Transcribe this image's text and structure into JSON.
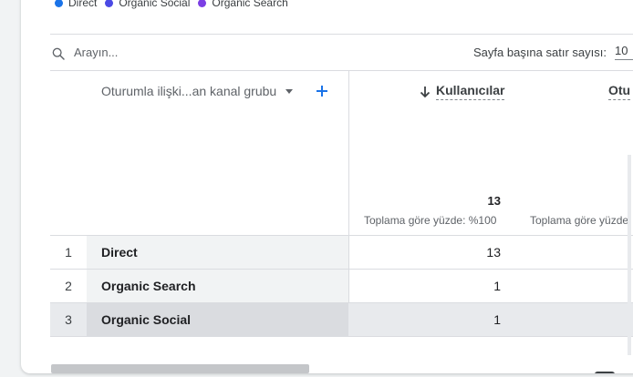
{
  "legend": [
    {
      "label": "Direct",
      "color": "#1a73e8"
    },
    {
      "label": "Organic Social",
      "color": "#4b4ae4"
    },
    {
      "label": "Organic Search",
      "color": "#7b3fe4"
    }
  ],
  "search": {
    "placeholder": "Arayın..."
  },
  "pagination": {
    "rows_per_page_label": "Sayfa başına satır sayısı:",
    "rows_per_page_value": "10"
  },
  "table": {
    "dimension_header": "Oturumla ilişki...an kanal grubu",
    "columns": [
      {
        "label": "Kullanıcılar",
        "total": "13",
        "total_pct": "Toplama göre yüzde: %100",
        "sorted": true
      },
      {
        "label": "Otu",
        "total": "",
        "total_pct": "Toplama göre yüzde",
        "sorted": false
      }
    ],
    "rows": [
      {
        "index": "1",
        "dimension": "Direct",
        "value": "13"
      },
      {
        "index": "2",
        "dimension": "Organic Search",
        "value": "1"
      },
      {
        "index": "3",
        "dimension": "Organic Social",
        "value": "1"
      }
    ]
  },
  "icons": {
    "search": "search-icon",
    "add": "plus-icon",
    "sort": "arrow-down-icon",
    "chevron": "chevron-down-icon"
  },
  "colors": {
    "accent": "#1a73e8",
    "row_shaded": "#e8eaed",
    "dim_shaded": "#f1f3f4"
  }
}
